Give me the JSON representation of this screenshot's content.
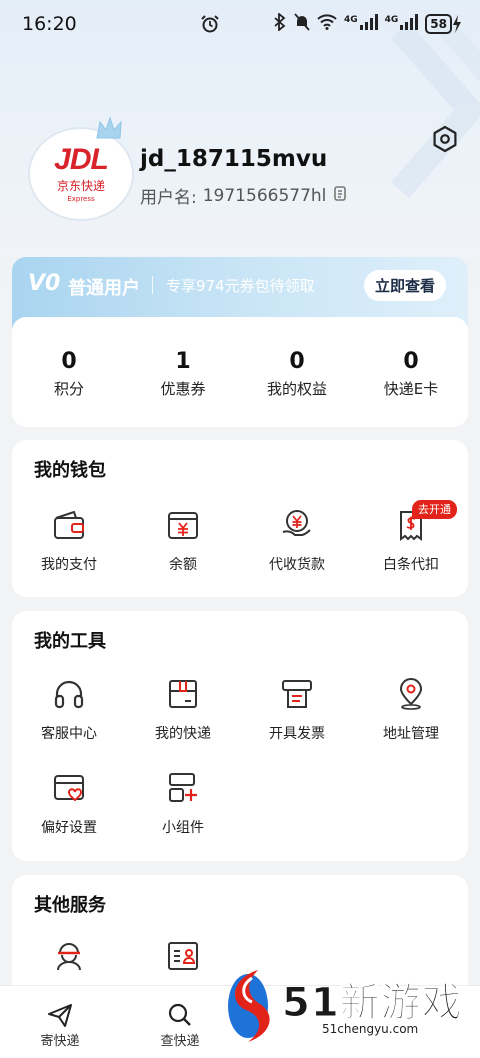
{
  "status_bar": {
    "time": "16:20",
    "battery": "58",
    "signal_1": "4G",
    "signal_2": "4G"
  },
  "profile": {
    "avatar_logo": "JDL",
    "avatar_cn": "京东快递",
    "avatar_en": "Express",
    "username": "jd_187115mvu",
    "user_label": "用户名:",
    "user_id": "1971566577hl"
  },
  "vip": {
    "badge": "V0",
    "level": "普通用户",
    "promo": "专享974元券包待领取",
    "button": "立即查看"
  },
  "stats": [
    {
      "value": "0",
      "label": "积分"
    },
    {
      "value": "1",
      "label": "优惠券"
    },
    {
      "value": "0",
      "label": "我的权益"
    },
    {
      "value": "0",
      "label": "快递E卡"
    }
  ],
  "wallet": {
    "title": "我的钱包",
    "items": [
      {
        "label": "我的支付",
        "icon": "wallet-icon"
      },
      {
        "label": "余额",
        "icon": "balance-icon"
      },
      {
        "label": "代收货款",
        "icon": "cod-icon"
      },
      {
        "label": "白条代扣",
        "icon": "receipt-icon"
      }
    ],
    "badge": "去开通"
  },
  "tools": {
    "title": "我的工具",
    "items": [
      {
        "label": "客服中心",
        "icon": "headset-icon"
      },
      {
        "label": "我的快递",
        "icon": "package-icon"
      },
      {
        "label": "开具发票",
        "icon": "invoice-icon"
      },
      {
        "label": "地址管理",
        "icon": "location-icon"
      },
      {
        "label": "偏好设置",
        "icon": "preference-icon"
      },
      {
        "label": "小组件",
        "icon": "widget-icon"
      }
    ]
  },
  "other": {
    "title": "其他服务",
    "items": [
      {
        "icon": "courier-icon"
      },
      {
        "icon": "id-card-icon"
      }
    ]
  },
  "tabbar": [
    {
      "label": "寄快递",
      "icon": "send-icon"
    },
    {
      "label": "查快递",
      "icon": "search-icon"
    }
  ],
  "watermark": {
    "text": "51新游戏",
    "url": "51chengyu.com"
  },
  "colors": {
    "accent": "#e2231a",
    "vip_blue": "#a9d4f0"
  }
}
